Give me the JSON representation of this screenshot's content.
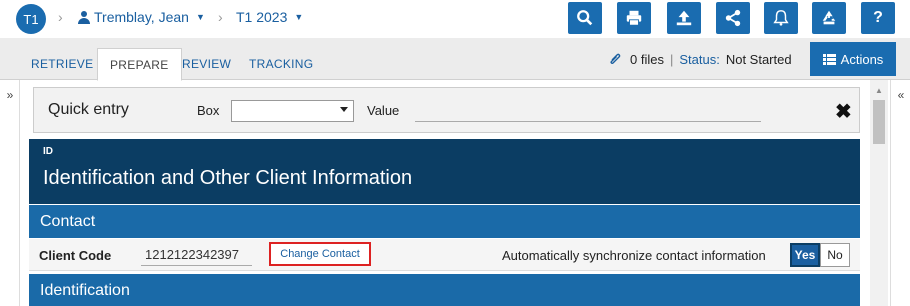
{
  "header": {
    "badge": "T1",
    "client_name": "Tremblay, Jean",
    "year": "T1 2023",
    "toolbar_icons": [
      "search-icon",
      "print-icon",
      "upload-icon",
      "share-icon",
      "bell-icon",
      "recycle-icon",
      "help-icon"
    ],
    "help_label": "?"
  },
  "tabs": [
    {
      "label": "RETRIEVE"
    },
    {
      "label": "PREPARE"
    },
    {
      "label": "REVIEW"
    },
    {
      "label": "TRACKING"
    }
  ],
  "status_bar": {
    "files": "0 files",
    "separator": "|",
    "status_label": "Status:",
    "status_value": "Not Started",
    "actions_label": "Actions"
  },
  "side": {
    "left_arrow": "»",
    "right_arrow": "«"
  },
  "quick_entry": {
    "title": "Quick entry",
    "box_label": "Box",
    "box_value": "",
    "value_label": "Value",
    "value_value": "",
    "close_glyph": "✖"
  },
  "form": {
    "id": "ID",
    "title": "Identification and Other Client Information",
    "contact_section": "Contact",
    "client_code_label": "Client Code",
    "client_code_value": "1212122342397",
    "change_contact_label": "Change Contact",
    "sync_label": "Automatically synchronize contact information",
    "yes_label": "Yes",
    "no_label": "No",
    "identification_section": "Identification"
  },
  "colors": {
    "accent": "#1a6cb0",
    "header_dark": "#0b3d63",
    "section_blue": "#1a6aa8",
    "highlight_red": "#d22222"
  }
}
